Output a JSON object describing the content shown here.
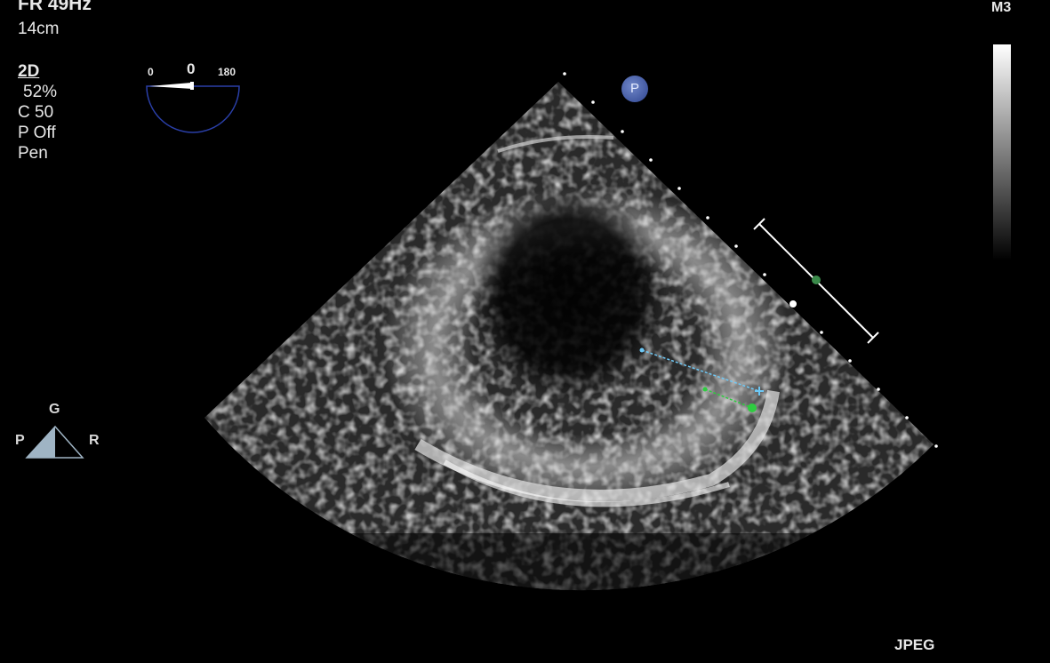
{
  "overlay": {
    "frame_rate": "FR 49Hz",
    "depth": "14cm",
    "mode": "2D",
    "gain": "52%",
    "compression": "C 50",
    "persistence": "P Off",
    "preset": "Pen",
    "map": "M3",
    "format": "JPEG"
  },
  "angle_indicator": {
    "min_label": "0",
    "max_label": "180",
    "value_label": "0"
  },
  "orientation": {
    "top": "G",
    "left": "P",
    "right": "R"
  },
  "probe_marker": "P",
  "measurements": {
    "caliper_blue_color": "#6ec8f5",
    "caliper_green_color": "#2ecc40",
    "scale_bar_color": "#ffffff"
  }
}
